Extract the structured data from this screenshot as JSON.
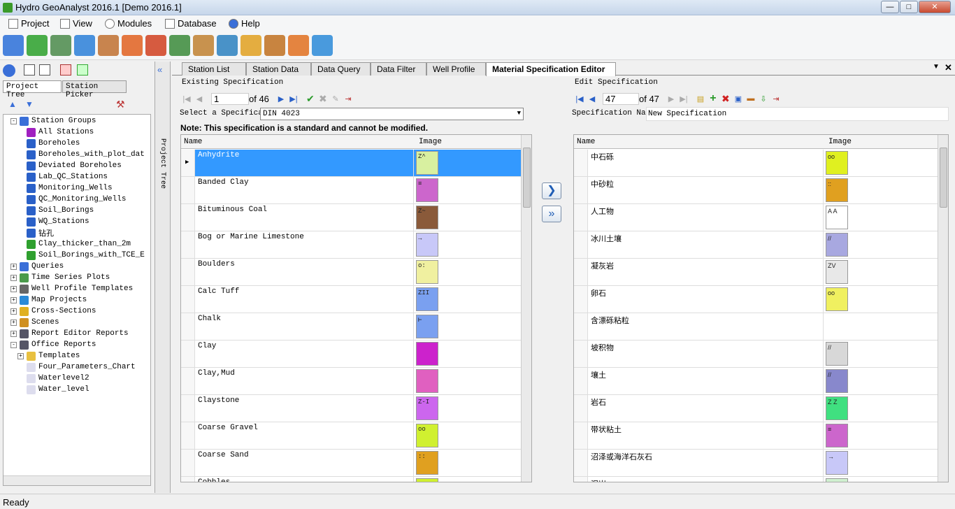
{
  "app": {
    "title": "Hydro GeoAnalyst 2016.1 [Demo 2016.1]"
  },
  "menu": [
    "Project",
    "View",
    "Modules",
    "Database",
    "Help"
  ],
  "toolbar_icons": [
    "borehole-icon",
    "validate-icon",
    "database-icon",
    "stack-icon",
    "report-icon",
    "chart-icon",
    "calendar-icon",
    "graph-icon",
    "cross-section-icon",
    "globe-icon",
    "map-icon",
    "layers-icon",
    "volume-icon",
    "triangle-icon"
  ],
  "left": {
    "tabs": [
      "Project Tree",
      "Station Picker"
    ],
    "vertical_tab": "Project Tree",
    "tree": [
      {
        "label": "Station Groups",
        "depth": 0,
        "exp": "-",
        "color": "#3a6fd8"
      },
      {
        "label": "All Stations",
        "depth": 1,
        "color": "#a020c0"
      },
      {
        "label": "Boreholes",
        "depth": 1,
        "color": "#2a60c8"
      },
      {
        "label": "Boreholes_with_plot_dat",
        "depth": 1,
        "color": "#2a60c8"
      },
      {
        "label": "Deviated Boreholes",
        "depth": 1,
        "color": "#2a60c8"
      },
      {
        "label": "Lab_QC_Stations",
        "depth": 1,
        "color": "#2a60c8"
      },
      {
        "label": "Monitoring_Wells",
        "depth": 1,
        "color": "#2a60c8"
      },
      {
        "label": "QC_Monitoring_Wells",
        "depth": 1,
        "color": "#2a60c8"
      },
      {
        "label": "Soil_Borings",
        "depth": 1,
        "color": "#2a60c8"
      },
      {
        "label": "WQ_Stations",
        "depth": 1,
        "color": "#2a60c8"
      },
      {
        "label": "钻孔",
        "depth": 1,
        "color": "#2a60c8"
      },
      {
        "label": "Clay_thicker_than_2m",
        "depth": 1,
        "color": "#2fa02f"
      },
      {
        "label": "Soil_Borings_with_TCE_E",
        "depth": 1,
        "color": "#2fa02f"
      },
      {
        "label": "Queries",
        "depth": 0,
        "exp": "+",
        "color": "#3a6fd8"
      },
      {
        "label": "Time Series Plots",
        "depth": 0,
        "exp": "+",
        "color": "#4a9a4a"
      },
      {
        "label": "Well Profile Templates",
        "depth": 0,
        "exp": "+",
        "color": "#666"
      },
      {
        "label": "Map Projects",
        "depth": 0,
        "exp": "+",
        "color": "#2a8ad8"
      },
      {
        "label": "Cross-Sections",
        "depth": 0,
        "exp": "+",
        "color": "#e0b020"
      },
      {
        "label": "Scenes",
        "depth": 0,
        "exp": "+",
        "color": "#d09020"
      },
      {
        "label": "Report Editor Reports",
        "depth": 0,
        "exp": "+",
        "color": "#556"
      },
      {
        "label": "Office Reports",
        "depth": 0,
        "exp": "-",
        "color": "#556"
      },
      {
        "label": "Templates",
        "depth": 1,
        "exp": "+",
        "color": "#e8c040"
      },
      {
        "label": "Four_Parameters_Chart",
        "depth": 1,
        "color": "#dde"
      },
      {
        "label": "Waterlevel2",
        "depth": 1,
        "color": "#dde"
      },
      {
        "label": "Water_level",
        "depth": 1,
        "color": "#dde"
      }
    ]
  },
  "tabs": [
    "Station List",
    "Station Data",
    "Data Query",
    "Data Filter",
    "Well Profile",
    "Material Specification Editor"
  ],
  "existing": {
    "section": "Existing Specification",
    "page": "1",
    "of": "of 46",
    "select_label": "Select a Specificat",
    "select_value": "DIN 4023",
    "note": "Note: This specification is a standard and cannot be modified.",
    "col_name": "Name",
    "col_image": "Image",
    "rows": [
      {
        "name": "Anhydrite",
        "pat": "#d8f0a0",
        "txt": "Z^"
      },
      {
        "name": "Banded Clay",
        "pat": "#cc66cc",
        "txt": "≡"
      },
      {
        "name": "Bituminous Coal",
        "pat": "#8a5a3a",
        "txt": "Z~"
      },
      {
        "name": "Bog or Marine Limestone",
        "pat": "#c8c8f8",
        "txt": "→"
      },
      {
        "name": "Boulders",
        "pat": "#f0f0a0",
        "txt": "o:"
      },
      {
        "name": "Calc Tuff",
        "pat": "#7aa0f0",
        "txt": "ZII"
      },
      {
        "name": "Chalk",
        "pat": "#7aa0f0",
        "txt": "⊢"
      },
      {
        "name": "Clay",
        "pat": "#cc22cc",
        "txt": ""
      },
      {
        "name": "Clay,Mud",
        "pat": "#e060c0",
        "txt": ""
      },
      {
        "name": "Claystone",
        "pat": "#cc66ee",
        "txt": "Z-I"
      },
      {
        "name": "Coarse Gravel",
        "pat": "#d0f030",
        "txt": "oo"
      },
      {
        "name": "Coarse Sand",
        "pat": "#e0a020",
        "txt": "::"
      },
      {
        "name": "Cobbles",
        "pat": "#d0f030",
        "txt": ""
      }
    ]
  },
  "edit": {
    "section": "Edit Specification",
    "page": "47",
    "of": "of 47",
    "name_label": "Specification Name",
    "name_value": "New Specification",
    "col_name": "Name",
    "col_image": "Image",
    "rows": [
      {
        "name": "中石砾",
        "pat": "#e0f020",
        "txt": "oo"
      },
      {
        "name": "中砂粒",
        "pat": "#e0a020",
        "txt": "::"
      },
      {
        "name": "人工物",
        "pat": "#ffffff",
        "txt": "A A"
      },
      {
        "name": "冰川土壤",
        "pat": "#a8a8e0",
        "txt": "//"
      },
      {
        "name": "凝灰岩",
        "pat": "#e8e8e8",
        "txt": "ZV"
      },
      {
        "name": "卵石",
        "pat": "#f0f060",
        "txt": "oo"
      },
      {
        "name": "含漂砾粘粒",
        "pat": "",
        "txt": ""
      },
      {
        "name": "坡积物",
        "pat": "#d8d8d8",
        "txt": "//"
      },
      {
        "name": "壤土",
        "pat": "#8888cc",
        "txt": "//"
      },
      {
        "name": "岩石",
        "pat": "#40e080",
        "txt": "Z Z"
      },
      {
        "name": "带状粘土",
        "pat": "#cc66cc",
        "txt": "≡"
      },
      {
        "name": "沼泽或海洋石灰石",
        "pat": "#c8c8f8",
        "txt": "→"
      },
      {
        "name": "泥岩",
        "pat": "#d0f0d0",
        "txt": ""
      }
    ]
  },
  "status": "Ready"
}
